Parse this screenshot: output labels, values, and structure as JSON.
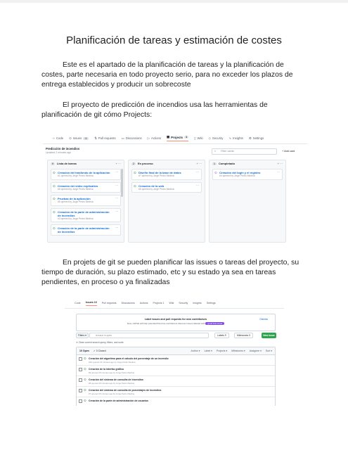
{
  "title": "Planificación de tareas y estimación de costes",
  "paragraphs": [
    "Este es el apartado de la planificación de tareas y la planificación de costes, parte necesaria en todo proyecto serio, para no exceder los plazos de entrega establecidos y producir un sobrecoste",
    "El proyecto de predicción de incendios usa las herramientas de planificación de git cómo Projects:",
    "En projets de git se pueden planificar las issues o tareas del proyecto, su tiempo de duración, su plazo estimado, etc y su estado ya sea en tareas pendientes, en proceso o ya finalizadas"
  ],
  "board": {
    "nav": [
      {
        "label": "Code",
        "icon": "code-icon"
      },
      {
        "label": "Issues",
        "count": "10",
        "icon": "issue-icon"
      },
      {
        "label": "Pull requests",
        "icon": "pull-request-icon"
      },
      {
        "label": "Discussions",
        "icon": "discussion-icon"
      },
      {
        "label": "Actions",
        "icon": "play-icon"
      },
      {
        "label": "Projects",
        "count": "1",
        "icon": "project-icon",
        "active": true
      },
      {
        "label": "Wiki",
        "icon": "book-icon"
      },
      {
        "label": "Security",
        "icon": "shield-icon"
      },
      {
        "label": "Insights",
        "icon": "graph-icon"
      },
      {
        "label": "Settings",
        "icon": "gear-icon"
      }
    ],
    "project_name": "Predicción de incendios",
    "updated": "Updated 2 minutes ago",
    "filter_placeholder": "Filter cards",
    "add_column": "Add card",
    "columns": [
      {
        "count": "9",
        "name": "Lista de tareas",
        "cards": [
          {
            "title": "Creación del trasfondo de la aplicación",
            "sub": "#1 opened by Jorge Pedro Medina"
          },
          {
            "title": "Creación del video explicativo",
            "sub": "#6 opened by Jorge Pedro Medina"
          },
          {
            "title": "Pruebas de la aplicación",
            "sub": "#5 opened by Jorge Pedro Medina"
          },
          {
            "title": "Creación de la parte de administración de incendios",
            "sub": "#3 opened by Jorge Pedro Medina"
          },
          {
            "title": "Creación de la parte de administración de incendios",
            "sub": ""
          }
        ]
      },
      {
        "count": "2",
        "name": "En proceso",
        "cards": [
          {
            "title": "Diseño final de la base de datos",
            "sub": "#7 opened by Jorge Pedro Medina"
          },
          {
            "title": "Creación de la web",
            "sub": "#5 opened by Jorge Pedro Medina"
          }
        ]
      },
      {
        "count": "1",
        "name": "Completado",
        "cards": [
          {
            "title": "Creación del login y el registro",
            "sub": "#4 opened by Jorge Pedro Medina",
            "closed": true
          }
        ]
      }
    ]
  },
  "issues": {
    "nav": [
      {
        "label": "Code"
      },
      {
        "label": "Issues 10",
        "active": true
      },
      {
        "label": "Pull requests"
      },
      {
        "label": "Discussions"
      },
      {
        "label": "Actions"
      },
      {
        "label": "Projects 1"
      },
      {
        "label": "Wiki"
      },
      {
        "label": "Security"
      },
      {
        "label": "Insights"
      },
      {
        "label": "Settings"
      }
    ],
    "banner_title": "Label issues and pull requests for new contributors",
    "banner_sub": "Now, GitHub will help potential first-time contributors discover issues labeled with",
    "banner_pill": "good first issue",
    "dismiss": "Dismiss",
    "filters_btn": "Filters ▾",
    "search_placeholder": "is:issue is:open",
    "labels_btn": "Labels 9",
    "milestones_btn": "Milestones 0",
    "new_issue": "New issue",
    "clear_query": "Clear current search query, filters, and sorts",
    "open_count": "10 Open",
    "closed_count": "✓ 0 Closed",
    "head_right": [
      "Author ▾",
      "Label ▾",
      "Projects ▾",
      "Milestones ▾",
      "Assignee ▾",
      "Sort ▾"
    ],
    "rows": [
      {
        "title": "Creación del algoritmo para el calculo del porcentaje de un incendio",
        "sub": "#10 opened 15 minutes ago by Jorge Pedro Medina"
      },
      {
        "title": "Creación de la interfaz gráfica",
        "sub": "#9 opened 15 minutes ago by Jorge Pedro Medina"
      },
      {
        "title": "Creación del sistema de consulta de incendios",
        "sub": "#8 opened 15 minutes ago by Jorge Pedro Medina"
      },
      {
        "title": "Creación del sistema de consulta de porcentajes de incendios",
        "sub": "#7 opened 15 minutes ago by Jorge Pedro Medina"
      },
      {
        "title": "Creación de la parte de administración de usuarios",
        "sub": ""
      }
    ]
  }
}
